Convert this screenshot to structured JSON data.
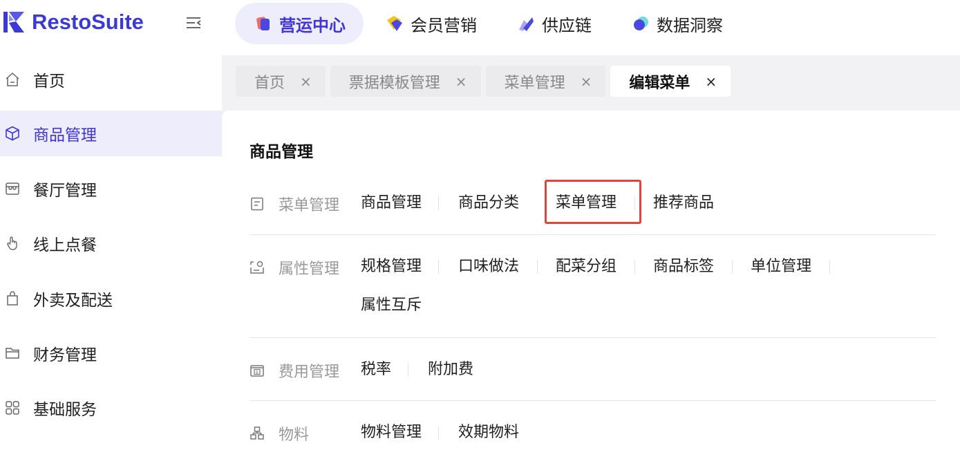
{
  "brand": {
    "name": "RestoSuite",
    "accent": "#4034d6",
    "highlight": "#e0453b"
  },
  "topnav": [
    {
      "label": "营运中心",
      "icon": "operations-icon",
      "active": true
    },
    {
      "label": "会员营销",
      "icon": "member-marketing-icon",
      "active": false
    },
    {
      "label": "供应链",
      "icon": "supply-chain-icon",
      "active": false
    },
    {
      "label": "数据洞察",
      "icon": "data-insight-icon",
      "active": false
    }
  ],
  "sidebar": [
    {
      "label": "首页",
      "icon": "home-icon",
      "active": false
    },
    {
      "label": "商品管理",
      "icon": "cube-icon",
      "active": true
    },
    {
      "label": "餐厅管理",
      "icon": "store-icon",
      "active": false
    },
    {
      "label": "线上点餐",
      "icon": "hand-pointer-icon",
      "active": false
    },
    {
      "label": "外卖及配送",
      "icon": "bag-icon",
      "active": false
    },
    {
      "label": "财务管理",
      "icon": "folder-icon",
      "active": false
    },
    {
      "label": "基础服务",
      "icon": "grid-icon",
      "active": false
    }
  ],
  "tabs": [
    {
      "label": "首页",
      "close": "×",
      "active": false
    },
    {
      "label": "票据模板管理",
      "close": "×",
      "active": false
    },
    {
      "label": "菜单管理",
      "close": "×",
      "active": false
    },
    {
      "label": "编辑菜单",
      "close": "×",
      "active": true
    }
  ],
  "panel": {
    "title": "商品管理",
    "groups": [
      {
        "label": "菜单管理",
        "icon": "document-icon",
        "links": [
          "商品管理",
          "商品分类",
          "菜单管理",
          "推荐商品"
        ],
        "highlighted": "菜单管理"
      },
      {
        "label": "属性管理",
        "icon": "attribute-icon",
        "links": [
          "规格管理",
          "口味做法",
          "配菜分组",
          "商品标签",
          "单位管理",
          "属性互斥"
        ]
      },
      {
        "label": "费用管理",
        "icon": "money-icon",
        "links": [
          "税率",
          "附加费"
        ]
      },
      {
        "label": "物料",
        "icon": "material-icon",
        "links": [
          "物料管理",
          "效期物料"
        ]
      }
    ]
  }
}
